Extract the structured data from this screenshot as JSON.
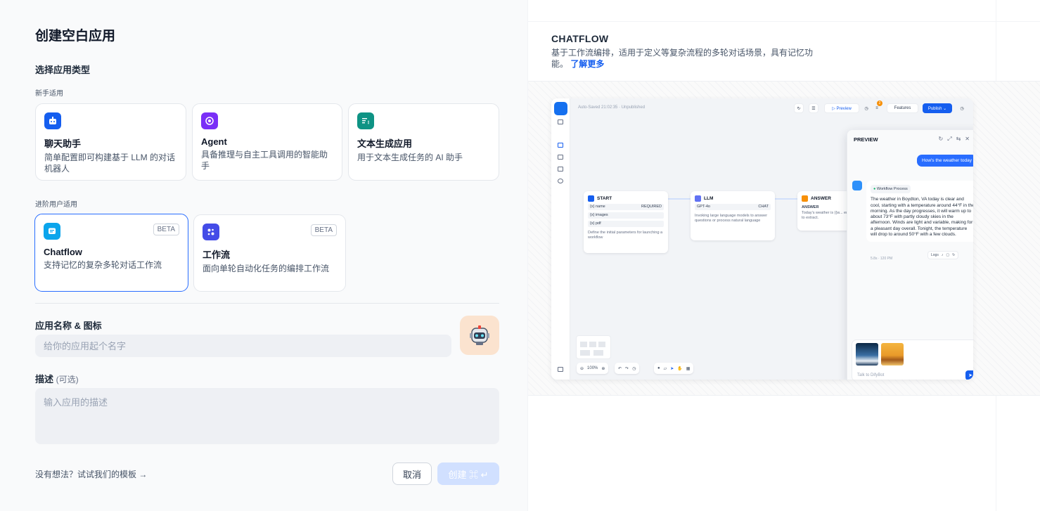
{
  "dialog": {
    "title": "创建空白应用",
    "choose_type": "选择应用类型",
    "beginner_label": "新手适用",
    "advanced_label": "进阶用户适用",
    "beginner_types": [
      {
        "name": "聊天助手",
        "desc": "简单配置即可构建基于 LLM 的对话机器人",
        "color": "#155eef"
      },
      {
        "name": "Agent",
        "desc": "具备推理与自主工具调用的智能助手",
        "color": "#7a2ff7"
      },
      {
        "name": "文本生成应用",
        "desc": "用于文本生成任务的 AI 助手",
        "color": "#0e9384"
      }
    ],
    "advanced_types": [
      {
        "name": "Chatflow",
        "desc": "支持记忆的复杂多轮对话工作流",
        "badge": "BETA",
        "color": "#0ba5ec",
        "selected": true
      },
      {
        "name": "工作流",
        "desc": "面向单轮自动化任务的编排工作流",
        "badge": "BETA",
        "color": "#444ce7",
        "selected": false
      }
    ],
    "name_label": "应用名称 & 图标",
    "name_placeholder": "给你的应用起个名字",
    "desc_label": "描述",
    "desc_optional": "(可选)",
    "desc_placeholder": "输入应用的描述",
    "template_link": "没有想法？试试我们的模板 →",
    "cancel_label": "取消",
    "create_label": "创建 ⌘ ↵"
  },
  "preview": {
    "title": "CHATFLOW",
    "desc": "基于工作流编排，适用于定义等复杂流程的多轮对话场景，具有记忆功能。",
    "learn_more": "了解更多",
    "mock": {
      "autosave": "Auto-Saved 21:02:35 · Unpublished",
      "btn_preview": "▷ Preview",
      "btn_features": "Features",
      "btn_publish": "Publish ⌄",
      "badge_count": "2",
      "start_node": {
        "title": "START",
        "rows": [
          {
            "k": "{x} name",
            "v": "REQUIRED"
          },
          {
            "k": "{x} images",
            "v": ""
          },
          {
            "k": "{x} pdf",
            "v": ""
          }
        ],
        "desc": "Define the initial parameters for launching a workflow"
      },
      "llm_node": {
        "title": "LLM",
        "model": "GPT-4o",
        "mode": "CHAT",
        "desc": "Invoking large language models to answer questions or process natural language"
      },
      "answer_node": {
        "title": "ANSWER",
        "label": "ANSWER",
        "text": "Today's weather is {{w... entities to extract."
      },
      "zoom": "100%",
      "chat": {
        "title": "PREVIEW",
        "user_msg": "How's the weather today",
        "process_tag": "Workflow Process",
        "bot_msg": "The weather in Boydton, VA today is clear and cool, starting with a temperature around 44°F in the morning. As the day progresses, it will warm up to about 73°F with partly cloudy skies in the afternoon. Winds are light and variable, making for a pleasant day overall. Tonight, the temperature will drop to around 50°F with a few clouds.",
        "meta": "5.8s · 120 PM",
        "logs": "Logs",
        "input_placeholder": "Talk to DifyBot"
      }
    }
  },
  "colors": {
    "primary": "#155eef",
    "selected_border": "#296dff",
    "avatar_bg": "#fbe3cf"
  }
}
